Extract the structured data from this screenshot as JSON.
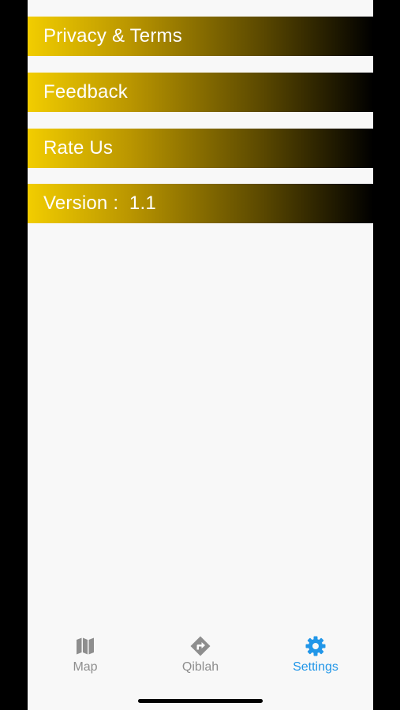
{
  "settings": {
    "items": [
      {
        "label": "Privacy & Terms"
      },
      {
        "label": "Feedback"
      },
      {
        "label": "Rate Us"
      },
      {
        "label": "Version :  1.1"
      }
    ]
  },
  "tabbar": {
    "tabs": [
      {
        "label": "Map",
        "icon": "map-icon",
        "active": false
      },
      {
        "label": "Qiblah",
        "icon": "direction-sign-icon",
        "active": false
      },
      {
        "label": "Settings",
        "icon": "gear-icon",
        "active": true
      }
    ],
    "active_color": "#2196e8",
    "inactive_color": "#8e8e8e"
  },
  "colors": {
    "row_gradient_start": "#f2cd00",
    "row_gradient_end": "#000000",
    "background": "#f8f8f8"
  }
}
